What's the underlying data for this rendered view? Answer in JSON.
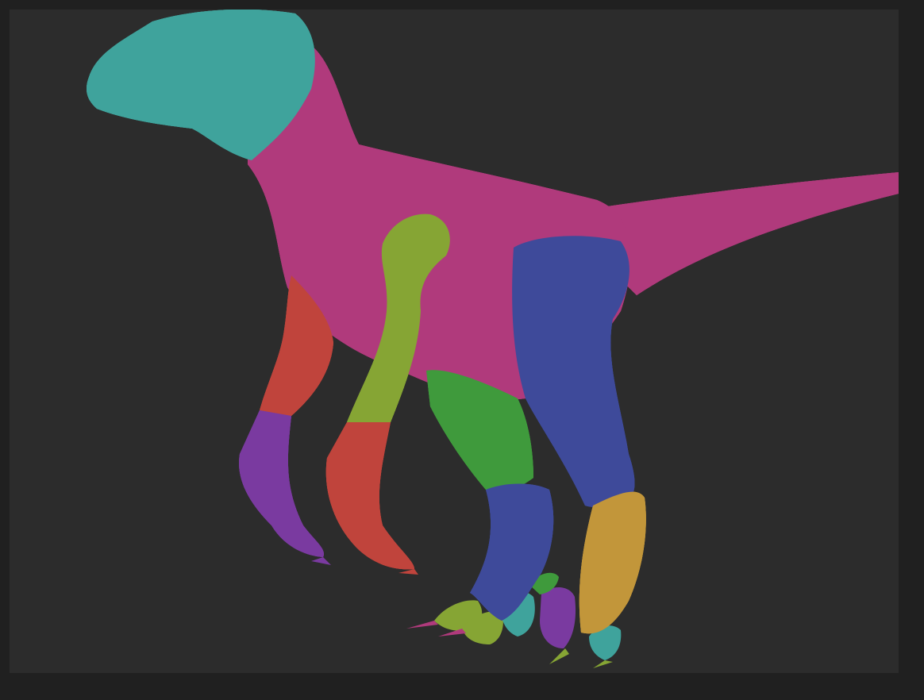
{
  "scene": {
    "subject": "raptor-sculpt-polygroups",
    "background_color": "#2c2c2c",
    "frame_color": "#202020",
    "polygroup_colors": {
      "head": "#3fa39c",
      "body": "#b03a7c",
      "tail": "#b03a7c",
      "arm_upper_left": "#c0443c",
      "arm_upper_right": "#86a534",
      "hand_left": "#7a3aa0",
      "hand_right": "#c0443c",
      "thigh_right": "#3e4a9a",
      "thigh_left": "#3f9a3c",
      "shin_left": "#3e4a9a",
      "shin_right": "#c2963a",
      "toe_claws_green": "#86a534",
      "toe_claws_teal": "#3fa39c",
      "toe_claws_purple": "#7a3aa0",
      "claw_tips": "#b03a7c"
    }
  }
}
